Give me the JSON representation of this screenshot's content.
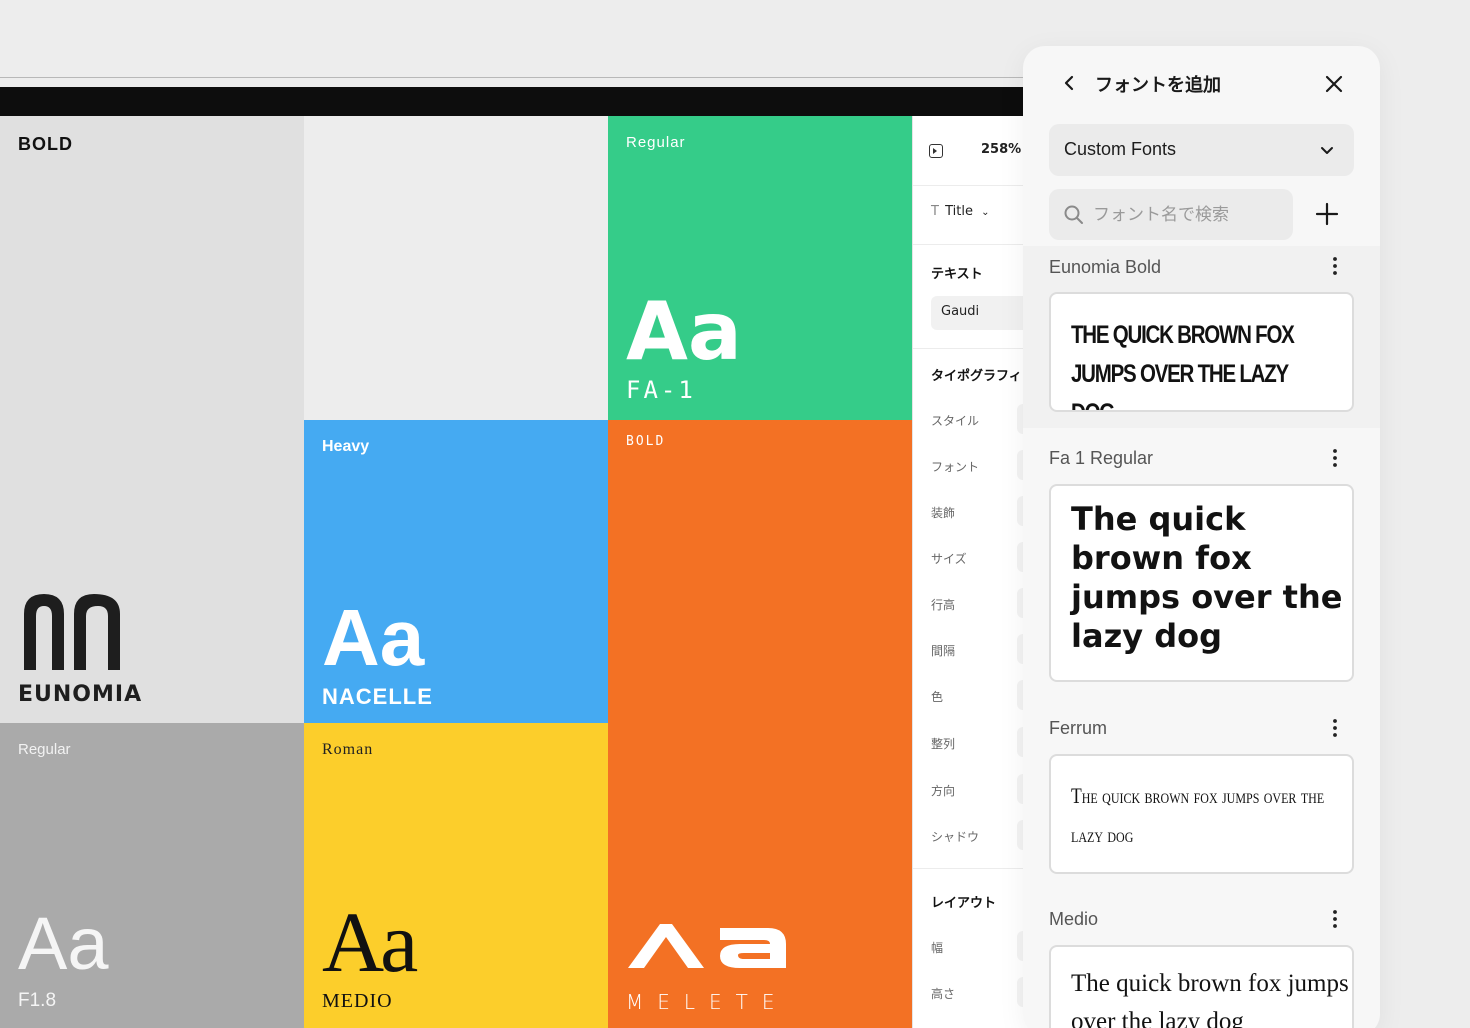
{
  "canvas": {
    "tiles": [
      {
        "id": "eunomia",
        "style_label": "BOLD",
        "name": "EUNOMIA",
        "color": "#e0e0e0"
      },
      {
        "id": "fa1",
        "style_label": "Regular",
        "sample": "Aa",
        "name": "FA-1",
        "color": "#35cc89"
      },
      {
        "id": "nacelle",
        "style_label": "Heavy",
        "sample": "Aa",
        "name": "NACELLE",
        "color": "#45aaf2"
      },
      {
        "id": "melete",
        "style_label": "BOLD",
        "name": "MELETE",
        "color": "#f37124"
      },
      {
        "id": "f18",
        "style_label": "Regular",
        "sample": "Aa",
        "name": "F1.8",
        "color": "#aaaaaa"
      },
      {
        "id": "medio",
        "style_label": "Roman",
        "sample": "Aa",
        "name": "MEDIO",
        "color": "#fcce2b"
      }
    ]
  },
  "properties": {
    "zoom": "258%",
    "style_select": "Title",
    "text_section": "テキスト",
    "text_value": "Gaudi",
    "typography_section": "タイポグラフィ",
    "typography_rows": [
      "スタイル",
      "フォント",
      "装飾",
      "サイズ",
      "行高",
      "間隔",
      "色",
      "整列",
      "方向",
      "シャドウ"
    ],
    "layout_section": "レイアウト",
    "layout_rows": [
      "幅",
      "高さ"
    ]
  },
  "font_panel": {
    "title": "フォントを追加",
    "source_select": "Custom Fonts",
    "search_placeholder": "フォント名で検索",
    "fonts": [
      {
        "name": "Eunomia Bold",
        "preview": "THE QUICK BROWN FOX JUMPS OVER THE LAZY DOG"
      },
      {
        "name": "Fa 1 Regular",
        "preview": "The quick brown fox jumps over the lazy dog"
      },
      {
        "name": "Ferrum",
        "preview": "The quick brown fox jumps over the lazy dog"
      },
      {
        "name": "Medio",
        "preview": "The quick brown fox jumps over the lazy dog"
      }
    ]
  }
}
